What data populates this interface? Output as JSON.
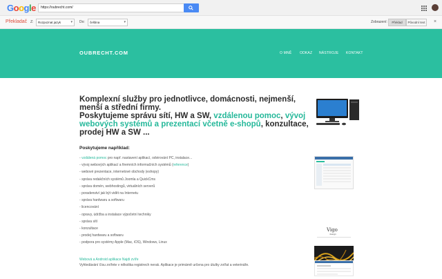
{
  "browser": {
    "logo_letters": [
      "G",
      "o",
      "o",
      "g",
      "l",
      "e"
    ],
    "url": "https://oubrecht.com/"
  },
  "translate_bar": {
    "title": "Překladač",
    "from_label": "Z:",
    "from_value": "Rozpoznat jazyk",
    "to_label": "Do:",
    "to_value": "čeština",
    "view_label": "Zobrazení:",
    "translated_button": "Překlad",
    "original_button": "Původní text",
    "close": "×"
  },
  "site": {
    "brand": "OUBRECHT.COM",
    "nav": [
      {
        "label": "O MNĚ"
      },
      {
        "label": "ODKAZ"
      },
      {
        "label": "NÁSTROJE"
      },
      {
        "label": "KONTAKT"
      }
    ],
    "headline_part1": "Komplexní služby pro jednotlivce, domácnosti, nejmenší, menší a střední firmy.",
    "headline_part2": "Poskytujeme správu sítí, HW a SW, ",
    "headline_link1": "vzdálenou pomoc",
    "headline_sep": ", ",
    "headline_link2": "vývoj webových systémů a prezentací včetně e-shopů",
    "headline_part3": ", konzultace, prodej HW a SW ...",
    "subheading": "Poskytujeme například:",
    "list": [
      {
        "prefix": "- ",
        "link": "vzdálená pomoc",
        "text": " pro např. nastavení aplikací, odvirování PC, instalace..."
      },
      {
        "prefix": "- ",
        "link": "",
        "text": "vývoj webových aplikací a firemních informačních systémů (",
        "link2": "reference",
        "suffix": ")"
      },
      {
        "prefix": "- ",
        "link": "",
        "text": "webové prezentace, internetové obchody (eshopy)"
      },
      {
        "prefix": "- ",
        "link": "",
        "text": "správa redakčních systémů Joomla a QuickCms"
      },
      {
        "prefix": "- ",
        "link": "",
        "text": "správa domén, webhostingů, virtuálních serverů"
      },
      {
        "prefix": "- ",
        "link": "",
        "text": "poradenství jak být vidět na Internetu"
      },
      {
        "prefix": "- ",
        "link": "",
        "text": "správa hardwaru a softwaru"
      },
      {
        "prefix": "- ",
        "link": "",
        "text": "licencování"
      },
      {
        "prefix": "- ",
        "link": "",
        "text": "opravy, údržba a instalace výpočetní techniky"
      },
      {
        "prefix": "- ",
        "link": "",
        "text": "správa sítí"
      },
      {
        "prefix": "- ",
        "link": "",
        "text": "konzultace"
      },
      {
        "prefix": "- ",
        "link": "",
        "text": "prodej hardwaru a softwaru"
      },
      {
        "prefix": "- ",
        "link": "",
        "text": "podpora pro systémy Apple (Mac, iOS), Windows, Linux"
      }
    ],
    "footer_link": "Webová a Android aplikace Najdi zvíře",
    "footer_text": "Vyhledávání čísu zvířete v několika registrech nerak. Aplikace je primárně určena pro útulky zvířat a veterináře."
  },
  "colors": {
    "teal": "#2bbfa0",
    "accent_text": "#25b89a"
  }
}
